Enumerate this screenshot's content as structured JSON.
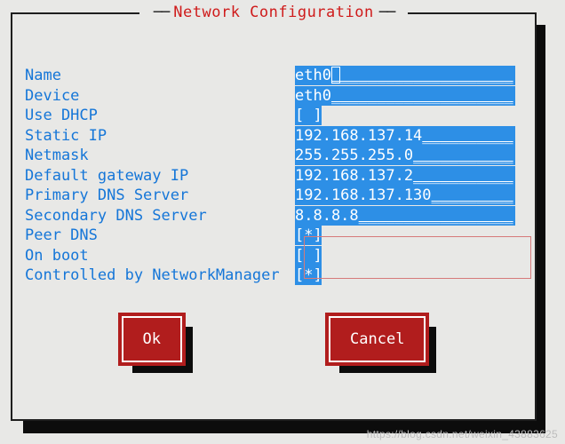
{
  "title": "Network Configuration",
  "fields": [
    {
      "label": "Name",
      "value": "eth0",
      "type": "text",
      "cursor": true,
      "hl": "full"
    },
    {
      "label": "Device",
      "value": "eth0",
      "type": "text",
      "hl": "full"
    },
    {
      "label": "Use DHCP",
      "value": "[ ]",
      "type": "check",
      "hl": "short"
    },
    {
      "label": "Static IP",
      "value": "192.168.137.14",
      "type": "text",
      "hl": "full"
    },
    {
      "label": "Netmask",
      "value": "255.255.255.0",
      "type": "text",
      "hl": "full"
    },
    {
      "label": "Default gateway IP",
      "value": "192.168.137.2",
      "type": "text",
      "hl": "full"
    },
    {
      "label": "Primary DNS Server",
      "value": "192.168.137.130",
      "type": "text",
      "hl": "full"
    },
    {
      "label": "Secondary DNS Server",
      "value": "8.8.8.8",
      "type": "text",
      "hl": "full"
    },
    {
      "label": "Peer DNS",
      "value": "[*]",
      "type": "check",
      "hl": "short"
    },
    {
      "label": "On boot",
      "value": "[ ]",
      "type": "check",
      "hl": "short"
    },
    {
      "label": "Controlled by NetworkManager",
      "value": "[*]",
      "type": "check",
      "hl": "short"
    }
  ],
  "buttons": {
    "ok": "Ok",
    "cancel": "Cancel"
  },
  "watermark": "https://blog.csdn.net/weixin_43883625"
}
